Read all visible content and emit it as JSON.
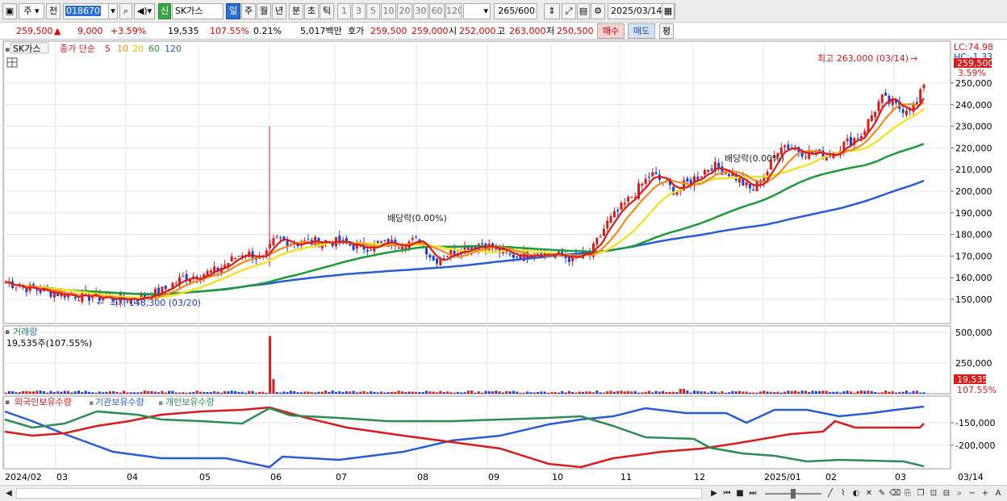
{
  "toolbar": {
    "mode_label": "주",
    "prev_label": "전",
    "code_value": "018670",
    "badge_label": "신",
    "name_value": "SK가스",
    "periods": [
      "일",
      "주",
      "월",
      "년",
      "분",
      "초",
      "틱"
    ],
    "active_period": "일",
    "numbers": [
      "1",
      "3",
      "5",
      "10",
      "20",
      "30",
      "60",
      "120"
    ],
    "count_value": "265",
    "count_total": "/600",
    "date_value": "2025/03/14"
  },
  "quote": {
    "price": "259,500",
    "change": "9,000",
    "change_pct": "+3.59%",
    "volume": "19,535",
    "vol_ratio": "107.55%",
    "turnover": "0.21%",
    "amount": "5,017백만",
    "bid_label": "호가",
    "bid1": "259,500",
    "bid2": "259,000",
    "open_label": "시",
    "open": "252,000",
    "high_label": "고",
    "high": "263,000",
    "low_label": "저",
    "low": "250,500",
    "buy_label": "매수",
    "sell_label": "매도",
    "eval_label": "평"
  },
  "price_panel": {
    "stock_label": "SK가스",
    "legend_title": "종가 단순",
    "ma": [
      {
        "label": "5",
        "color": "#d81b1b"
      },
      {
        "label": "10",
        "color": "#f08a1c"
      },
      {
        "label": "20",
        "color": "#f2e22a"
      },
      {
        "label": "60",
        "color": "#1f9a3a"
      },
      {
        "label": "120",
        "color": "#2a5bd7"
      }
    ],
    "y_ticks": [
      "250,000",
      "240,000",
      "230,000",
      "220,000",
      "210,000",
      "200,000",
      "190,000",
      "180,000",
      "170,000",
      "160,000",
      "150,000"
    ],
    "max_note": "최고 263,000 (03/14)",
    "min_note": "최저 148,300 (03/20)",
    "div_note_1": "배당락(0.00%)",
    "div_note_2": "배당락(0.00%)",
    "corner_lc": "LC:74.98",
    "corner_hc": "HC:-1.33",
    "cur_price_tag": "259,500",
    "cur_pct_tag": "3.59%"
  },
  "volume_panel": {
    "title": "거래량",
    "value_text": "19,535주(107.55%)",
    "y_ticks": [
      "500,000",
      "250,000"
    ],
    "tag_value": "19,535",
    "tag_pct": "107.55%"
  },
  "holder_panel": {
    "series": [
      {
        "label": "외국인보유수량",
        "color": "#d81b1b"
      },
      {
        "label": "기관보유수량",
        "color": "#2a5bd7"
      },
      {
        "label": "개인보유수량",
        "color": "#2e8b57"
      }
    ],
    "y_ticks": [
      "-150,000",
      "-200,000"
    ]
  },
  "x_axis": {
    "labels": [
      "2024/02",
      "03",
      "04",
      "05",
      "06",
      "07",
      "08",
      "09",
      "10",
      "11",
      "12",
      "2025/01",
      "02",
      "03"
    ],
    "last_date": "03/14"
  },
  "colors": {
    "up": "#d81b1b",
    "down": "#1c3fd6",
    "grid": "#e2e2e2"
  }
}
